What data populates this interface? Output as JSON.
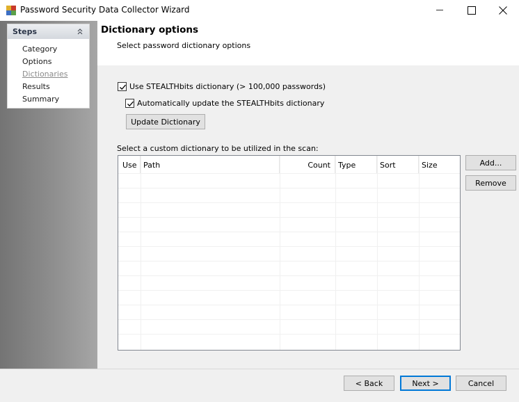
{
  "window": {
    "title": "Password Security Data Collector Wizard"
  },
  "steps": {
    "title": "Steps",
    "items": [
      {
        "label": "Category",
        "current": false
      },
      {
        "label": "Options",
        "current": false
      },
      {
        "label": "Dictionaries",
        "current": true
      },
      {
        "label": "Results",
        "current": false
      },
      {
        "label": "Summary",
        "current": false
      }
    ]
  },
  "page": {
    "title": "Dictionary options",
    "subtitle": "Select password dictionary options"
  },
  "options": {
    "use_stealthbits": {
      "label": "Use STEALTHbits dictionary (> 100,000 passwords)",
      "checked": true
    },
    "auto_update": {
      "label": "Automatically update the STEALTHbits dictionary",
      "checked": true
    },
    "update_button": "Update Dictionary"
  },
  "custom": {
    "label": "Select a custom dictionary to be utilized in the scan:",
    "columns": [
      "Use",
      "Path",
      "Count",
      "Type",
      "Sort",
      "Size"
    ],
    "rows": [],
    "add_button": "Add...",
    "remove_button": "Remove"
  },
  "footer": {
    "back": "< Back",
    "next": "Next >",
    "cancel": "Cancel"
  },
  "colors": {
    "accent": "#0078d7",
    "panel_dark": "#747474",
    "panel_light": "#a6a6a6"
  }
}
